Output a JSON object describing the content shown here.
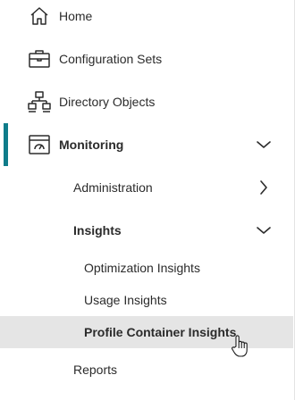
{
  "nav": {
    "home": {
      "label": "Home",
      "icon": "home-icon"
    },
    "config_sets": {
      "label": "Configuration Sets",
      "icon": "briefcase-icon"
    },
    "directory_objects": {
      "label": "Directory Objects",
      "icon": "org-tree-icon"
    },
    "monitoring": {
      "label": "Monitoring",
      "icon": "monitoring-dashboard-icon",
      "expanded": true,
      "children": {
        "administration": {
          "label": "Administration",
          "expanded": false
        },
        "insights": {
          "label": "Insights",
          "expanded": true,
          "children": {
            "optimization": {
              "label": "Optimization Insights"
            },
            "usage": {
              "label": "Usage Insights"
            },
            "profile_container": {
              "label": "Profile Container Insights",
              "hovered": true
            }
          }
        },
        "reports": {
          "label": "Reports"
        }
      }
    }
  },
  "colors": {
    "accent": "#0f7c8a",
    "hover_bg": "#e5e5e5",
    "text": "#2b2b2b"
  }
}
